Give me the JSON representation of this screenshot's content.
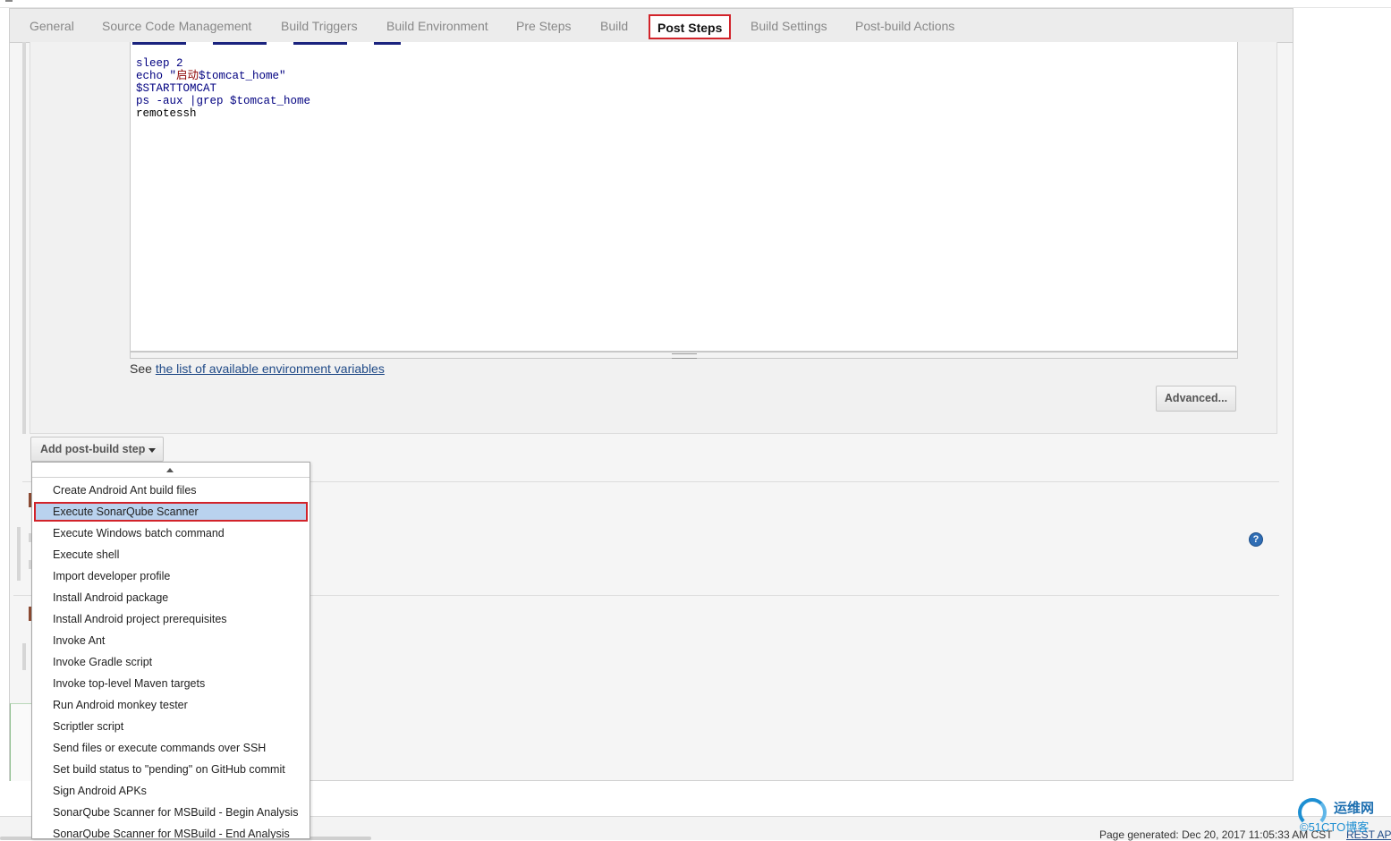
{
  "tabs": [
    {
      "label": "General"
    },
    {
      "label": "Source Code Management"
    },
    {
      "label": "Build Triggers"
    },
    {
      "label": "Build Environment"
    },
    {
      "label": "Pre Steps"
    },
    {
      "label": "Build"
    },
    {
      "label": "Post Steps",
      "active": true
    },
    {
      "label": "Build Settings"
    },
    {
      "label": "Post-build Actions"
    }
  ],
  "editor": {
    "lines": [
      {
        "text": "sleep 2"
      },
      {
        "text_prefix": "echo \"",
        "text_str": "启动",
        "text_suffix": "$tomcat_home\""
      },
      {
        "text": "$STARTTOMCAT"
      },
      {
        "text": "ps -aux |grep $tomcat_home"
      },
      {
        "text": "remotessh"
      }
    ]
  },
  "env_vars": {
    "prefix": "See ",
    "link_text": "the list of available environment variables"
  },
  "buttons": {
    "advanced": "Advanced...",
    "add_post_build_step": "Add post-build step"
  },
  "dropdown": {
    "items": [
      "Create Android Ant build files",
      "Execute SonarQube Scanner",
      "Execute Windows batch command",
      "Execute shell",
      "Import developer profile",
      "Install Android package",
      "Install Android project prerequisites",
      "Invoke Ant",
      "Invoke Gradle script",
      "Invoke top-level Maven targets",
      "Run Android monkey tester",
      "Scriptler script",
      "Send files or execute commands over SSH",
      "Set build status to \"pending\" on GitHub commit",
      "Sign Android APKs",
      "SonarQube Scanner for MSBuild - Begin Analysis",
      "SonarQube Scanner for MSBuild - End Analysis"
    ],
    "selected_index": 1
  },
  "footer": {
    "page_generated": "Page generated: Dec 20, 2017 11:05:33 AM CST",
    "rest_api": "REST API"
  },
  "watermark": {
    "line1": "运维网",
    "line2": "©51CTO博客"
  },
  "help": {
    "symbol": "?"
  },
  "colors": {
    "highlight": "#d2232a",
    "link": "#204a87",
    "selected_bg": "#b9d2ee"
  }
}
